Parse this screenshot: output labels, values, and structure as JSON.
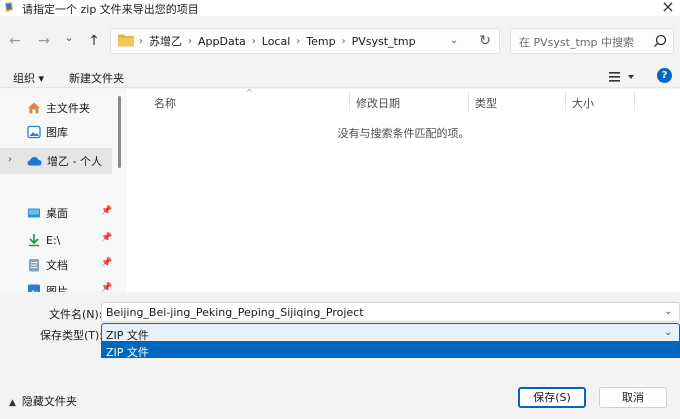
{
  "window": {
    "title": "请指定一个 zip 文件来导出您的项目",
    "close_glyph": "×"
  },
  "nav": {
    "back_glyph": "←",
    "forward_glyph": "→",
    "recent_glyph": "⌄",
    "up_glyph": "↑"
  },
  "address": {
    "crumbs": [
      "苏增乙",
      "AppData",
      "Local",
      "Temp",
      "PVsyst_tmp"
    ],
    "separator": "›",
    "dropdown_glyph": "⌄",
    "refresh_glyph": "↻"
  },
  "search": {
    "placeholder": "在 PVsyst_tmp 中搜索"
  },
  "toolbar": {
    "organize_label": "组织 ▾",
    "new_folder_label": "新建文件夹"
  },
  "sidebar": {
    "expand_glyph": "›",
    "pin_glyph": "📌",
    "items": [
      {
        "label": "主文件夹",
        "icon": "home-icon"
      },
      {
        "label": "图库",
        "icon": "gallery-icon"
      },
      {
        "label": "增乙 - 个人",
        "icon": "onedrive-icon"
      },
      {
        "label": "桌面",
        "icon": "desktop-icon"
      },
      {
        "label": "E:\\",
        "icon": "download-icon"
      },
      {
        "label": "文档",
        "icon": "document-icon"
      },
      {
        "label": "图片",
        "icon": "pictures-icon"
      }
    ]
  },
  "file_list": {
    "sort_glyph": "^",
    "columns": [
      "名称",
      "修改日期",
      "类型",
      "大小"
    ],
    "empty_message": "没有与搜索条件匹配的项。"
  },
  "form": {
    "filename_label": "文件名(N):",
    "filename_value": "Beijing_Bei-jing_Peking_Peping_Sijiqing_Project",
    "filetype_label": "保存类型(T):",
    "filetype_value": "ZIP 文件",
    "filetype_options": [
      "ZIP 文件"
    ],
    "dropdown_glyph": "⌄"
  },
  "footer": {
    "hide_folders_label": "隐藏文件夹",
    "save_label": "保存(S)",
    "cancel_label": "取消"
  },
  "colors": {
    "accent": "#0067c0",
    "folder": "#e8b43a"
  }
}
